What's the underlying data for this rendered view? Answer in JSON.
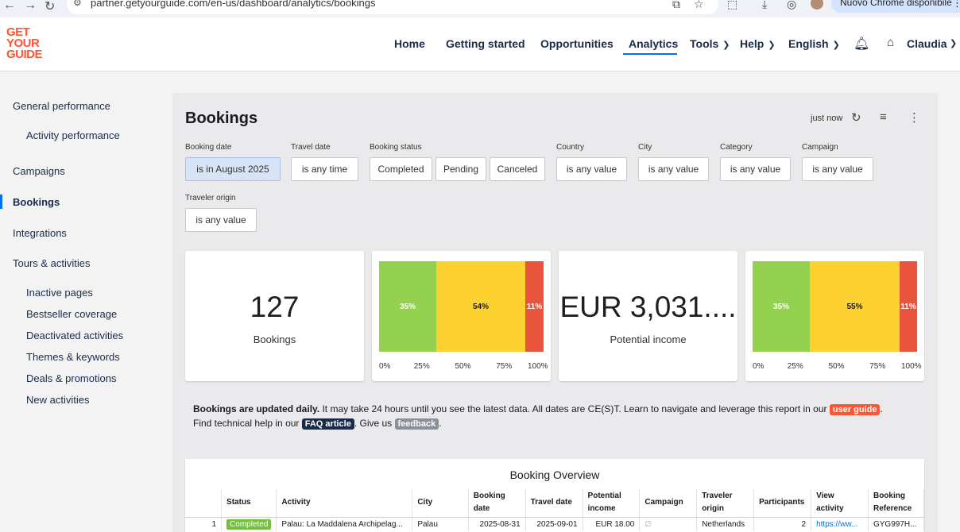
{
  "browser": {
    "url": "partner.getyourguide.com/en-us/dashboard/analytics/bookings",
    "update_label": "Nuovo Chrome disponibile"
  },
  "header": {
    "logo_lines": [
      "GET",
      "YOUR",
      "GUIDE"
    ],
    "nav": [
      {
        "label": "Home"
      },
      {
        "label": "Getting started"
      },
      {
        "label": "Opportunities"
      },
      {
        "label": "Analytics"
      },
      {
        "label": "Tools"
      },
      {
        "label": "Help"
      },
      {
        "label": "English"
      }
    ],
    "user_name": "Claudia",
    "active_nav": "Analytics"
  },
  "sidebar": {
    "items": [
      {
        "label": "General performance"
      },
      {
        "label": "Activity performance"
      },
      {
        "label": "Campaigns"
      },
      {
        "label": "Bookings"
      },
      {
        "label": "Integrations"
      },
      {
        "label": "Tours & activities"
      },
      {
        "label": "Inactive pages"
      },
      {
        "label": "Bestseller coverage"
      },
      {
        "label": "Deactivated activities"
      },
      {
        "label": "Themes & keywords"
      },
      {
        "label": "Deals & promotions"
      },
      {
        "label": "New activities"
      }
    ],
    "active": "Bookings"
  },
  "page": {
    "title": "Bookings",
    "last_refresh": "just now"
  },
  "filters": {
    "booking_date": {
      "label": "Booking date",
      "value": "is in August 2025"
    },
    "travel_date": {
      "label": "Travel date",
      "value": "is any time"
    },
    "booking_status": {
      "label": "Booking status",
      "options": [
        "Completed",
        "Pending",
        "Canceled"
      ]
    },
    "country": {
      "label": "Country",
      "value": "is any value"
    },
    "city": {
      "label": "City",
      "value": "is any value"
    },
    "category": {
      "label": "Category",
      "value": "is any value"
    },
    "campaign": {
      "label": "Campaign",
      "value": "is any value"
    },
    "traveler_origin": {
      "label": "Traveler origin",
      "value": "is any value"
    }
  },
  "kpis": {
    "bookings": {
      "value": "127",
      "label": "Bookings"
    },
    "income": {
      "value": "EUR 3,031....",
      "label": "Potential income"
    }
  },
  "chart_data": [
    {
      "type": "bar",
      "orientation": "horizontal-stacked",
      "series": [
        {
          "value": 35,
          "label": "35%",
          "color": "#93d14f"
        },
        {
          "value": 54,
          "label": "54%",
          "color": "#fdd12f"
        },
        {
          "value": 11,
          "label": "11%",
          "color": "#e8553c"
        }
      ],
      "ticks": [
        "0%",
        "25%",
        "50%",
        "75%",
        "100%"
      ],
      "xlim": [
        0,
        100
      ]
    },
    {
      "type": "bar",
      "orientation": "horizontal-stacked",
      "series": [
        {
          "value": 35,
          "label": "35%",
          "color": "#93d14f"
        },
        {
          "value": 55,
          "label": "55%",
          "color": "#fdd12f"
        },
        {
          "value": 11,
          "label": "11%",
          "color": "#e8553c"
        }
      ],
      "ticks": [
        "0%",
        "25%",
        "50%",
        "75%",
        "100%"
      ],
      "xlim": [
        0,
        100
      ]
    }
  ],
  "notice": {
    "bold": "Bookings are updated daily.",
    "text1": " It may take 24 hours until you see the latest data. All dates are CE(S)T. Learn to navigate and leverage this report in our ",
    "link1": "user guide",
    "text2": ". Find technical help in our ",
    "link2": "FAQ article",
    "text3": ". Give us ",
    "link3": "feedback",
    "text4": "."
  },
  "table": {
    "title": "Booking Overview",
    "columns": [
      "",
      "Status",
      "Activity",
      "City",
      "Booking date",
      "Travel date",
      "Potential income",
      "Campaign",
      "Traveler origin",
      "Participants",
      "View activity",
      "Booking Reference"
    ],
    "rows": [
      [
        "1",
        "Completed",
        "Palau: La Maddalena Archipelag...",
        "Palau",
        "2025-08-31",
        "2025-09-01",
        "EUR 18.00",
        "∅",
        "Netherlands",
        "2",
        "https://ww...",
        "GYG997H..."
      ]
    ]
  }
}
